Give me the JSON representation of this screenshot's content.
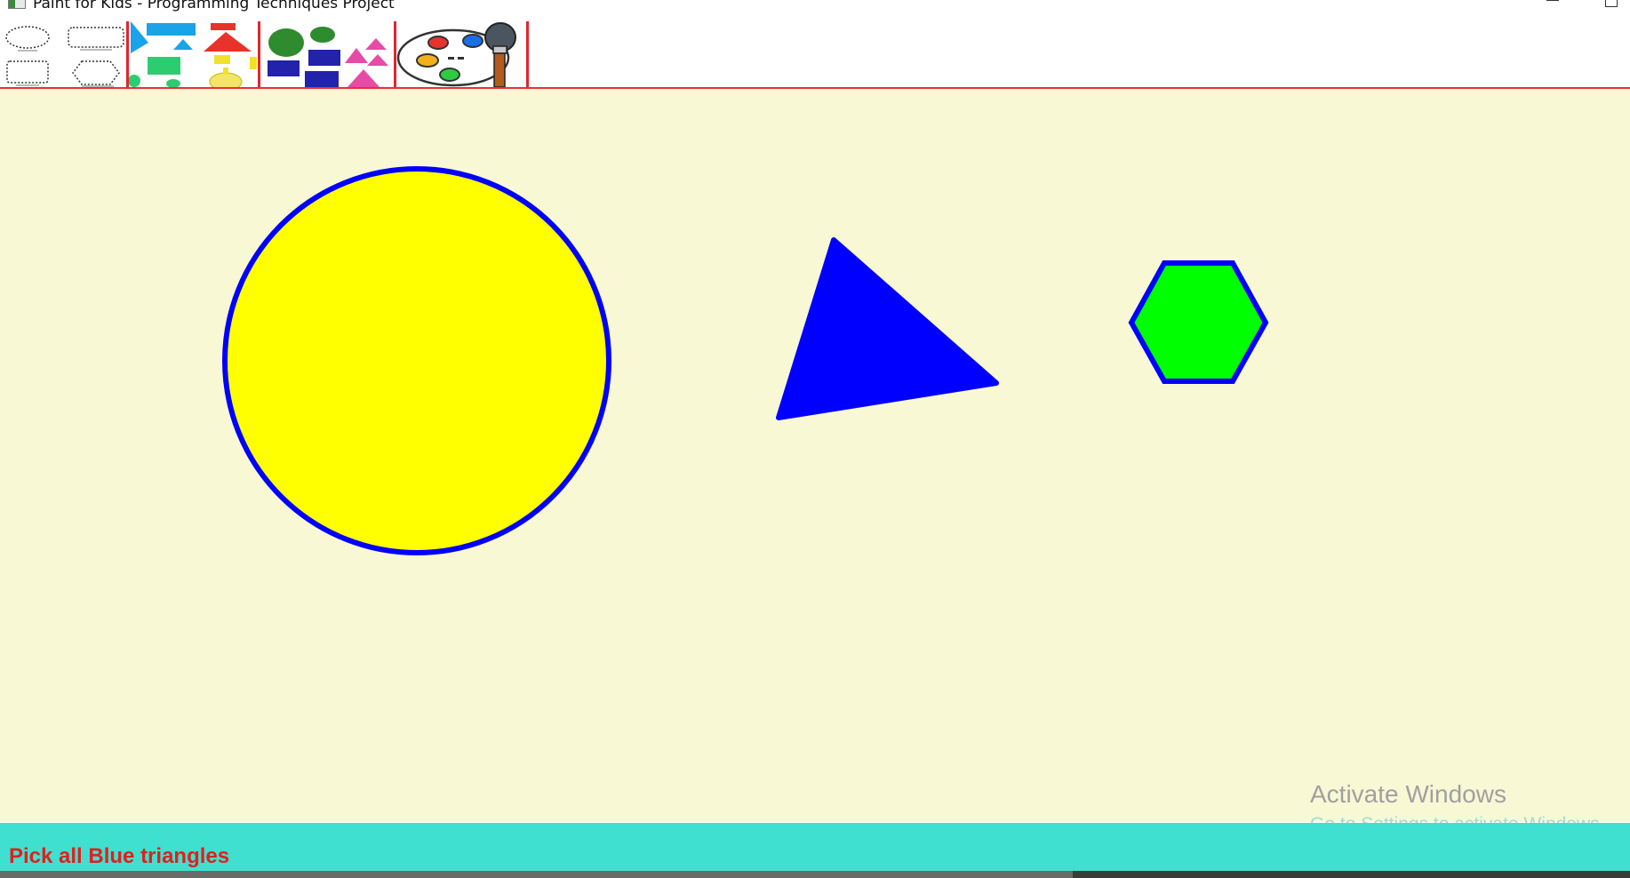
{
  "window": {
    "title": "Paint for Kids - Programming Techniques Project",
    "app_icon": "app-window-icon",
    "controls": [
      "minimize-icon",
      "maximize-icon"
    ]
  },
  "toolbar": {
    "tools": [
      {
        "name": "shapes-menu-icon",
        "description_icon": "outline-shapes-icon"
      },
      {
        "name": "pick-by-shape-icon"
      },
      {
        "name": "pick-by-color-icon"
      },
      {
        "name": "pick-by-shape-and-color-icon"
      },
      {
        "name": "color-palette-icon"
      }
    ],
    "separator_color": "#e0262c"
  },
  "canvas": {
    "background": "#f8f8d5",
    "shapes": [
      {
        "type": "circle",
        "fill": "#ffff00",
        "border": "#0000ff"
      },
      {
        "type": "triangle",
        "fill": "#0000ff",
        "border": "#0000ff"
      },
      {
        "type": "hexagon",
        "fill": "#00ff00",
        "border": "#0000ff"
      }
    ]
  },
  "watermark": {
    "title": "Activate Windows",
    "subtitle": "Go to Settings to activate Windows."
  },
  "statusbar": {
    "message": "Pick all Blue triangles",
    "background": "#40e0d0",
    "text_color": "#e0201e"
  }
}
